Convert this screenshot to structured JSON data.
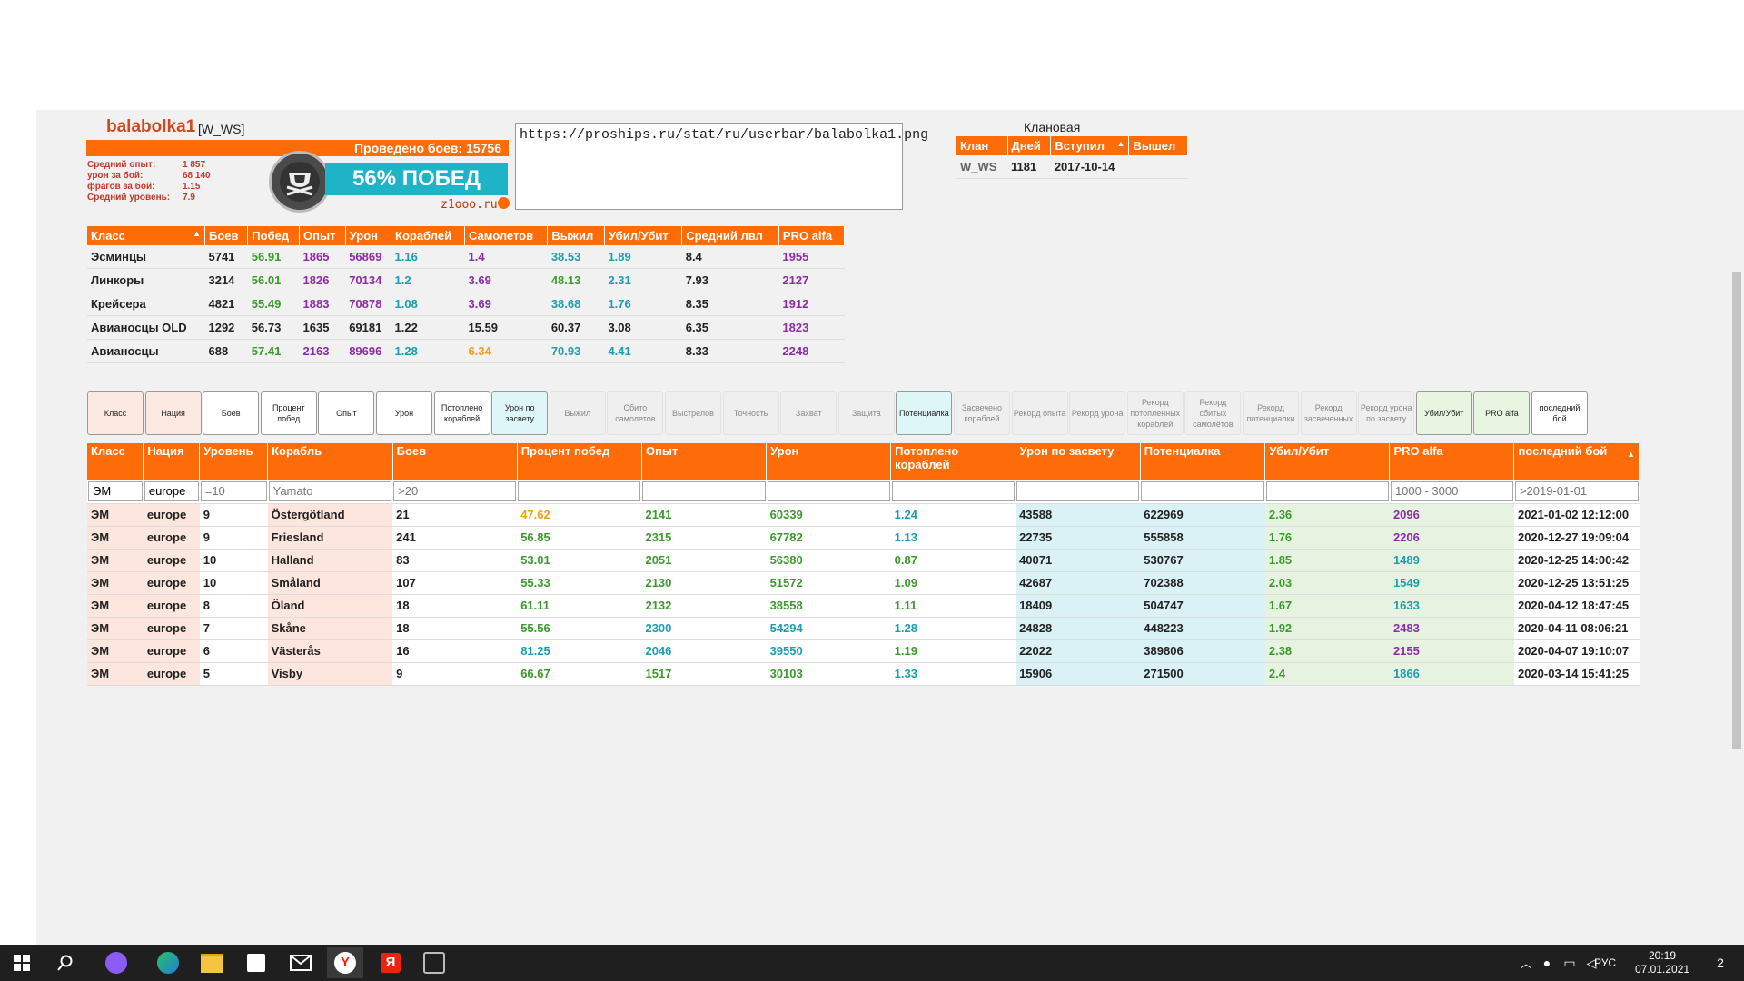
{
  "player": {
    "name": "balabolka1",
    "clan_tag": "[W_WS]",
    "battles_label": "Проведено боев: 15756",
    "stats": [
      {
        "label": "Средний опыт:",
        "value": "1 857"
      },
      {
        "label": "урон за бой:",
        "value": "68 140"
      },
      {
        "label": "фрагов за бой:",
        "value": "1.15"
      },
      {
        "label": "Средний уровень:",
        "value": "7.9"
      }
    ],
    "win_banner": "56% ПОБЕД",
    "logo_text": "z1ooo.ru"
  },
  "userbar_url": "https://proships.ru/stat/ru/userbar/balabolka1.png",
  "clan_history": {
    "title": "Клановая история",
    "headers": [
      "Клан",
      "Дней",
      "Вступил",
      "Вышел"
    ],
    "rows": [
      [
        "W_WS",
        "1181",
        "2017-10-14",
        ""
      ]
    ]
  },
  "class_table": {
    "headers": [
      "Класс",
      "Боев",
      "Побед",
      "Опыт",
      "Урон",
      "Кораблей",
      "Самолетов",
      "Выжил",
      "Убил/Убит",
      "Средний лвл",
      "PRO alfa"
    ],
    "rows": [
      [
        "Эсминцы",
        "5741",
        "56.91",
        "1865",
        "56869",
        "1.16",
        "1.4",
        "38.53",
        "1.89",
        "8.4",
        "1955"
      ],
      [
        "Линкоры",
        "3214",
        "56.01",
        "1826",
        "70134",
        "1.2",
        "3.69",
        "48.13",
        "2.31",
        "7.93",
        "2127"
      ],
      [
        "Крейсера",
        "4821",
        "55.49",
        "1883",
        "70878",
        "1.08",
        "3.69",
        "38.68",
        "1.76",
        "8.35",
        "1912"
      ],
      [
        "Авианосцы OLD",
        "1292",
        "56.73",
        "1635",
        "69181",
        "1.22",
        "15.59",
        "60.37",
        "3.08",
        "6.35",
        "1823"
      ],
      [
        "Авианосцы",
        "688",
        "57.41",
        "2163",
        "89696",
        "1.28",
        "6.34",
        "70.93",
        "4.41",
        "8.33",
        "2248"
      ]
    ]
  },
  "filter_buttons": [
    {
      "label": "Класс",
      "state": "pink"
    },
    {
      "label": "Нация",
      "state": "pink"
    },
    {
      "label": "Боев",
      "state": "on"
    },
    {
      "label": "Процент побед",
      "state": "on"
    },
    {
      "label": "Опыт",
      "state": "on"
    },
    {
      "label": "Урон",
      "state": "on"
    },
    {
      "label": "Потоплено кораблей",
      "state": "on"
    },
    {
      "label": "Урон по засвету",
      "state": "cyan"
    },
    {
      "label": "Выжил",
      "state": "off"
    },
    {
      "label": "Сбито самолетов",
      "state": "off"
    },
    {
      "label": "Выстрелов",
      "state": "off"
    },
    {
      "label": "Точность",
      "state": "off"
    },
    {
      "label": "Захват",
      "state": "off"
    },
    {
      "label": "Защита",
      "state": "off"
    },
    {
      "label": "Потенциалка",
      "state": "cyan"
    },
    {
      "label": "Засвечено кораблей",
      "state": "off"
    },
    {
      "label": "Рекорд опыта",
      "state": "off"
    },
    {
      "label": "Рекорд урона",
      "state": "off"
    },
    {
      "label": "Рекорд потопленных кораблей",
      "state": "off"
    },
    {
      "label": "Рекорд сбитых самолётов",
      "state": "off"
    },
    {
      "label": "Рекорд потенциалки",
      "state": "off"
    },
    {
      "label": "Рекорд засвеченных",
      "state": "off"
    },
    {
      "label": "Рекорд урона по засвету",
      "state": "off"
    },
    {
      "label": "Убил/Убит",
      "state": "green"
    },
    {
      "label": "PRO alfa",
      "state": "green"
    },
    {
      "label": "последний бой",
      "state": "on"
    }
  ],
  "ships_table": {
    "headers": [
      "Класс",
      "Нация",
      "Уровень",
      "Корабль",
      "Боев",
      "Процент побед",
      "Опыт",
      "Урон",
      "Потоплено кораблей",
      "Урон по засвету",
      "Потенциалка",
      "Убил/Убит",
      "PRO alfa",
      "последний бой"
    ],
    "filters": [
      {
        "value": "ЭМ",
        "placeholder": ""
      },
      {
        "value": "europe",
        "placeholder": ""
      },
      {
        "value": "",
        "placeholder": "=10"
      },
      {
        "value": "",
        "placeholder": "Yamato"
      },
      {
        "value": "",
        "placeholder": ">20"
      },
      {
        "value": "",
        "placeholder": ""
      },
      {
        "value": "",
        "placeholder": ""
      },
      {
        "value": "",
        "placeholder": ""
      },
      {
        "value": "",
        "placeholder": ""
      },
      {
        "value": "",
        "placeholder": ""
      },
      {
        "value": "",
        "placeholder": ""
      },
      {
        "value": "",
        "placeholder": ""
      },
      {
        "value": "",
        "placeholder": "1000 - 3000"
      },
      {
        "value": "",
        "placeholder": ">2019-01-01"
      }
    ],
    "rows": [
      [
        "ЭМ",
        "europe",
        "9",
        "Östergötland",
        "21",
        "47.62",
        "2141",
        "60339",
        "1.24",
        "43588",
        "622969",
        "2.36",
        "2096",
        "2021-01-02 12:12:00"
      ],
      [
        "ЭМ",
        "europe",
        "9",
        "Friesland",
        "241",
        "56.85",
        "2315",
        "67782",
        "1.13",
        "22735",
        "555858",
        "1.76",
        "2206",
        "2020-12-27 19:09:04"
      ],
      [
        "ЭМ",
        "europe",
        "10",
        "Halland",
        "83",
        "53.01",
        "2051",
        "56380",
        "0.87",
        "40071",
        "530767",
        "1.85",
        "1489",
        "2020-12-25 14:00:42"
      ],
      [
        "ЭМ",
        "europe",
        "10",
        "Småland",
        "107",
        "55.33",
        "2130",
        "51572",
        "1.09",
        "42687",
        "702388",
        "2.03",
        "1549",
        "2020-12-25 13:51:25"
      ],
      [
        "ЭМ",
        "europe",
        "8",
        "Öland",
        "18",
        "61.11",
        "2132",
        "38558",
        "1.11",
        "18409",
        "504747",
        "1.67",
        "1633",
        "2020-04-12 18:47:45"
      ],
      [
        "ЭМ",
        "europe",
        "7",
        "Skåne",
        "18",
        "55.56",
        "2300",
        "54294",
        "1.28",
        "24828",
        "448223",
        "1.92",
        "2483",
        "2020-04-11 08:06:21"
      ],
      [
        "ЭМ",
        "europe",
        "6",
        "Västerås",
        "16",
        "81.25",
        "2046",
        "39550",
        "1.19",
        "22022",
        "389806",
        "2.38",
        "2155",
        "2020-04-07 19:10:07"
      ],
      [
        "ЭМ",
        "europe",
        "5",
        "Visby",
        "9",
        "66.67",
        "1517",
        "30103",
        "1.33",
        "15906",
        "271500",
        "2.4",
        "1866",
        "2020-03-14 15:41:25"
      ]
    ],
    "color_classes": [
      [
        null,
        null,
        null,
        null,
        null,
        "c-orange",
        "c-green",
        "c-green",
        "c-teal",
        null,
        null,
        "c-green",
        "c-purple",
        null
      ],
      [
        null,
        null,
        null,
        null,
        null,
        "c-green",
        "c-green",
        "c-green",
        "c-teal",
        null,
        null,
        "c-green",
        "c-purple",
        null
      ],
      [
        null,
        null,
        null,
        null,
        null,
        "c-green",
        "c-green",
        "c-green",
        "c-green",
        null,
        null,
        "c-green",
        "c-teal",
        null
      ],
      [
        null,
        null,
        null,
        null,
        null,
        "c-green",
        "c-green",
        "c-green",
        "c-green",
        null,
        null,
        "c-green",
        "c-teal",
        null
      ],
      [
        null,
        null,
        null,
        null,
        null,
        "c-green",
        "c-green",
        "c-green",
        "c-green",
        null,
        null,
        "c-green",
        "c-teal",
        null
      ],
      [
        null,
        null,
        null,
        null,
        null,
        "c-green",
        "c-teal",
        "c-teal",
        "c-teal",
        null,
        null,
        "c-green",
        "c-purple",
        null
      ],
      [
        null,
        null,
        null,
        null,
        null,
        "c-teal",
        "c-teal",
        "c-teal",
        "c-green",
        null,
        null,
        "c-green",
        "c-purple",
        null
      ],
      [
        null,
        null,
        null,
        null,
        null,
        "c-green",
        "c-green",
        "c-green",
        "c-teal",
        null,
        null,
        "c-green",
        "c-teal",
        null
      ]
    ]
  },
  "class_color_classes": [
    [
      null,
      null,
      "c-green",
      "c-purple",
      "c-purple",
      "c-teal",
      "c-purple",
      "c-teal",
      "c-teal",
      null,
      "c-purple"
    ],
    [
      null,
      null,
      "c-green",
      "c-purple",
      "c-purple",
      "c-teal",
      "c-purple",
      "c-green",
      "c-teal",
      null,
      "c-purple"
    ],
    [
      null,
      null,
      "c-green",
      "c-purple",
      "c-purple",
      "c-teal",
      "c-purple",
      "c-teal",
      "c-teal",
      null,
      "c-purple"
    ],
    [
      null,
      null,
      null,
      null,
      null,
      null,
      null,
      null,
      null,
      null,
      "c-purple"
    ],
    [
      null,
      null,
      "c-green",
      "c-purple",
      "c-purple",
      "c-teal",
      "c-orange",
      "c-teal",
      "c-teal",
      null,
      "c-purple"
    ]
  ],
  "taskbar": {
    "lang": "РУС",
    "time": "20:19",
    "date": "07.01.2021",
    "notification_count": "2"
  },
  "colors": {
    "accent": "#fe6c0a",
    "win_banner": "#1fb3c8",
    "name": "#d2481a"
  }
}
